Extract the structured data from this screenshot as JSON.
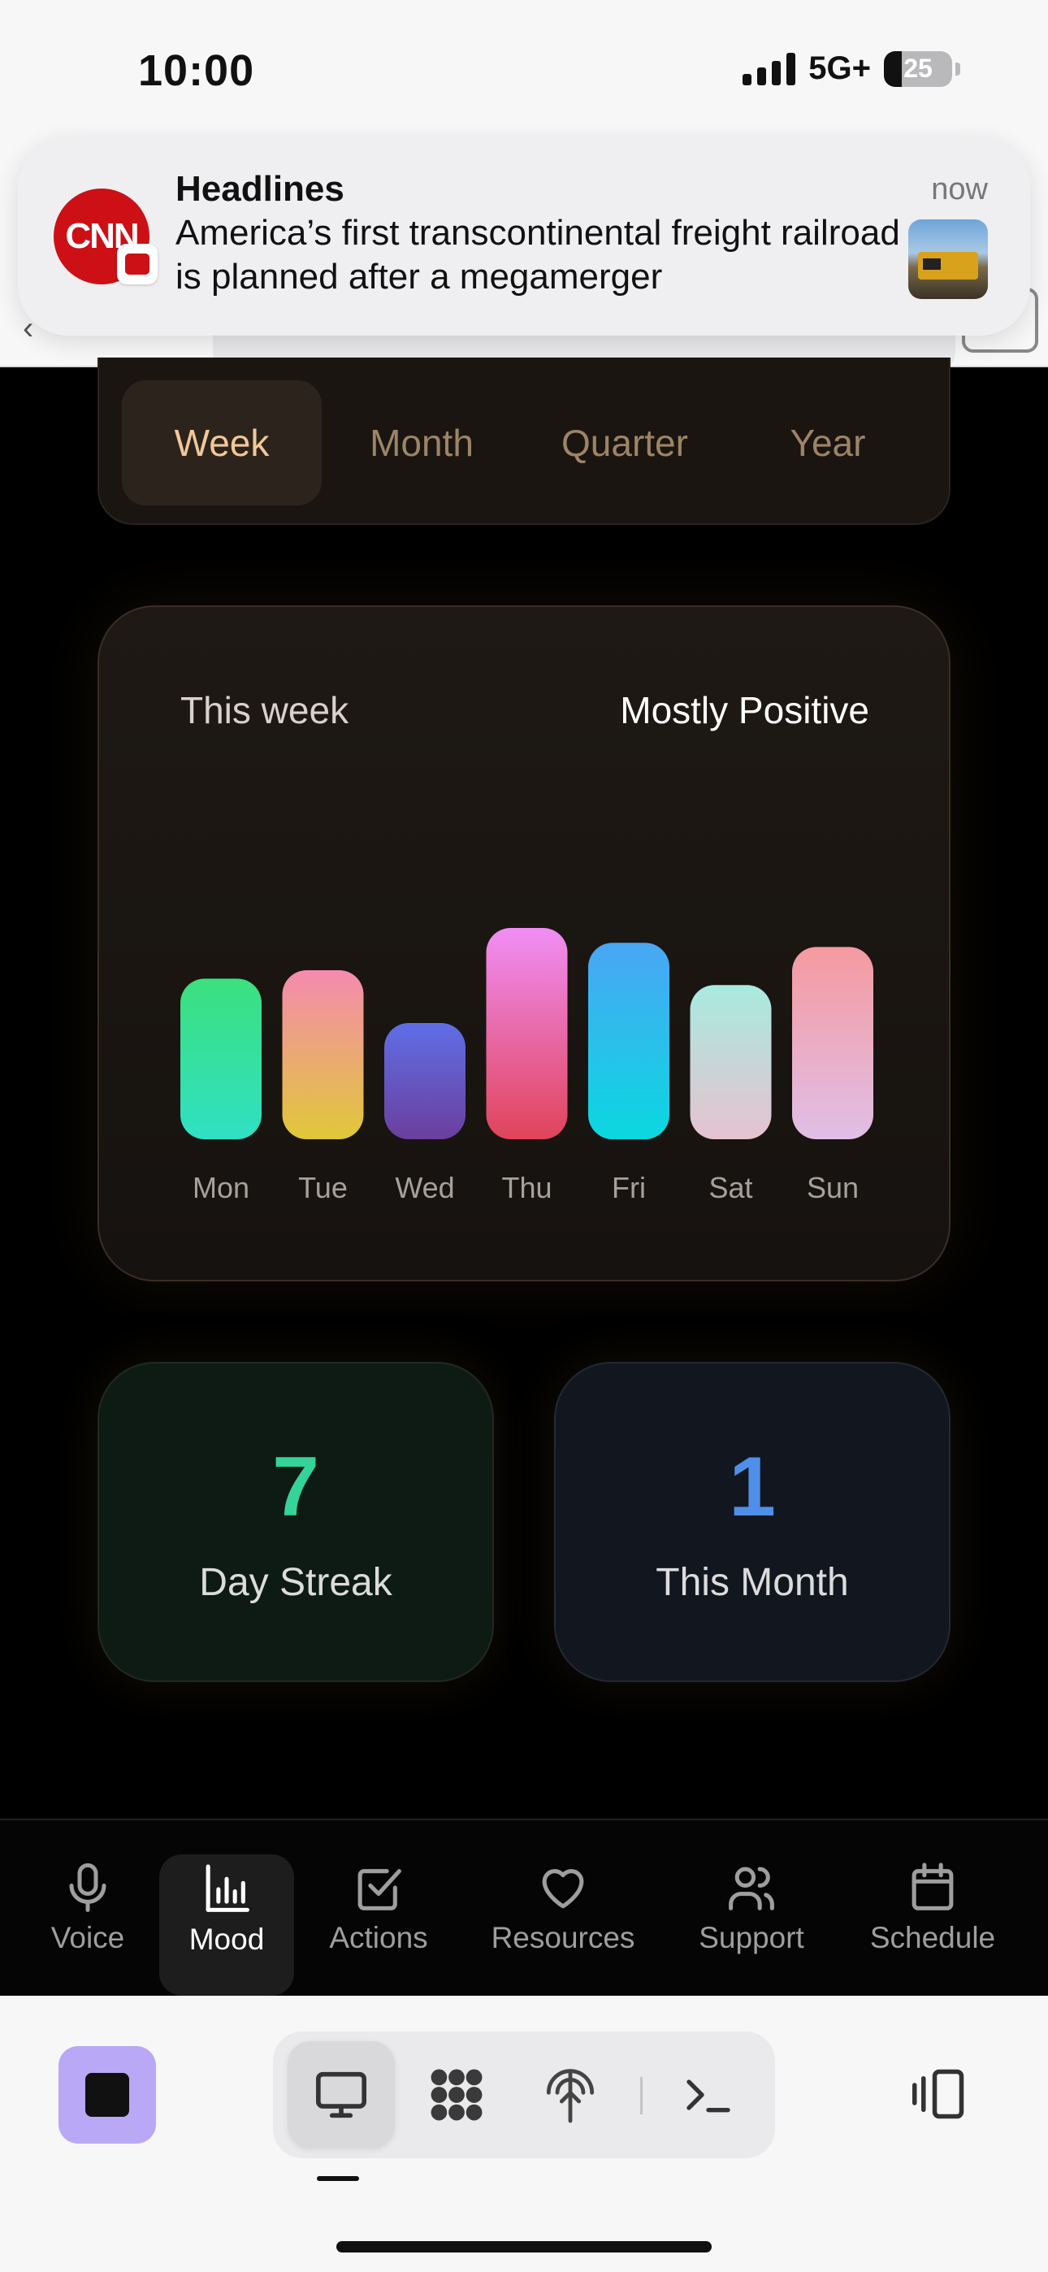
{
  "status_bar": {
    "time": "10:00",
    "network": "5G+",
    "battery": "25"
  },
  "notification": {
    "app": "Headlines",
    "time": "now",
    "body": "America’s first transcontinental freight railroad is planned after a megamerger",
    "logo_text": "CNN",
    "logo_icon": "cnn-logo-icon",
    "thumbnail_icon": "train-photo-thumbnail"
  },
  "period_tabs": {
    "items": [
      {
        "label": "Week",
        "active": true
      },
      {
        "label": "Month",
        "active": false
      },
      {
        "label": "Quarter",
        "active": false
      },
      {
        "label": "Year",
        "active": false
      }
    ]
  },
  "mood_chart": {
    "label": "This week",
    "summary": "Mostly Positive"
  },
  "chart_data": {
    "type": "bar",
    "categories": [
      "Mon",
      "Tue",
      "Wed",
      "Thu",
      "Fri",
      "Sat",
      "Sun"
    ],
    "values": [
      0.76,
      0.8,
      0.55,
      1.0,
      0.93,
      0.73,
      0.91
    ],
    "value_scale": "relative (fraction of tallest bar, no axis printed)",
    "colors": [
      [
        "#3ce07d",
        "#2fe0c3"
      ],
      [
        "#f58ab0",
        "#e0c838"
      ],
      [
        "#5f6ee6",
        "#6b3f9e"
      ],
      [
        "#f08ef5",
        "#e0445a"
      ],
      [
        "#4aa6f5",
        "#0ad8e0"
      ],
      [
        "#a8eadf",
        "#e6c2d0"
      ],
      [
        "#f59aa0",
        "#e0bfe6"
      ]
    ]
  },
  "stats": {
    "streak": {
      "value": "7",
      "label": "Day Streak",
      "color": "#34d399"
    },
    "month": {
      "value": "1",
      "label": "This Month",
      "color": "#4f8fe8"
    }
  },
  "tabbar": {
    "items": [
      {
        "label": "Voice",
        "icon": "microphone-icon",
        "active": false
      },
      {
        "label": "Mood",
        "icon": "bar-chart-icon",
        "active": true
      },
      {
        "label": "Actions",
        "icon": "checkbox-icon",
        "active": false
      },
      {
        "label": "Resources",
        "icon": "heart-icon",
        "active": false
      },
      {
        "label": "Support",
        "icon": "users-icon",
        "active": false
      },
      {
        "label": "Schedule",
        "icon": "calendar-icon",
        "active": false
      }
    ]
  },
  "toolbar": {
    "stop": "stop-icon",
    "tools": [
      "desktop-icon",
      "apps-grid-icon",
      "network-antenna-icon",
      "terminal-icon"
    ],
    "side": "sidebar-toggle-icon"
  }
}
